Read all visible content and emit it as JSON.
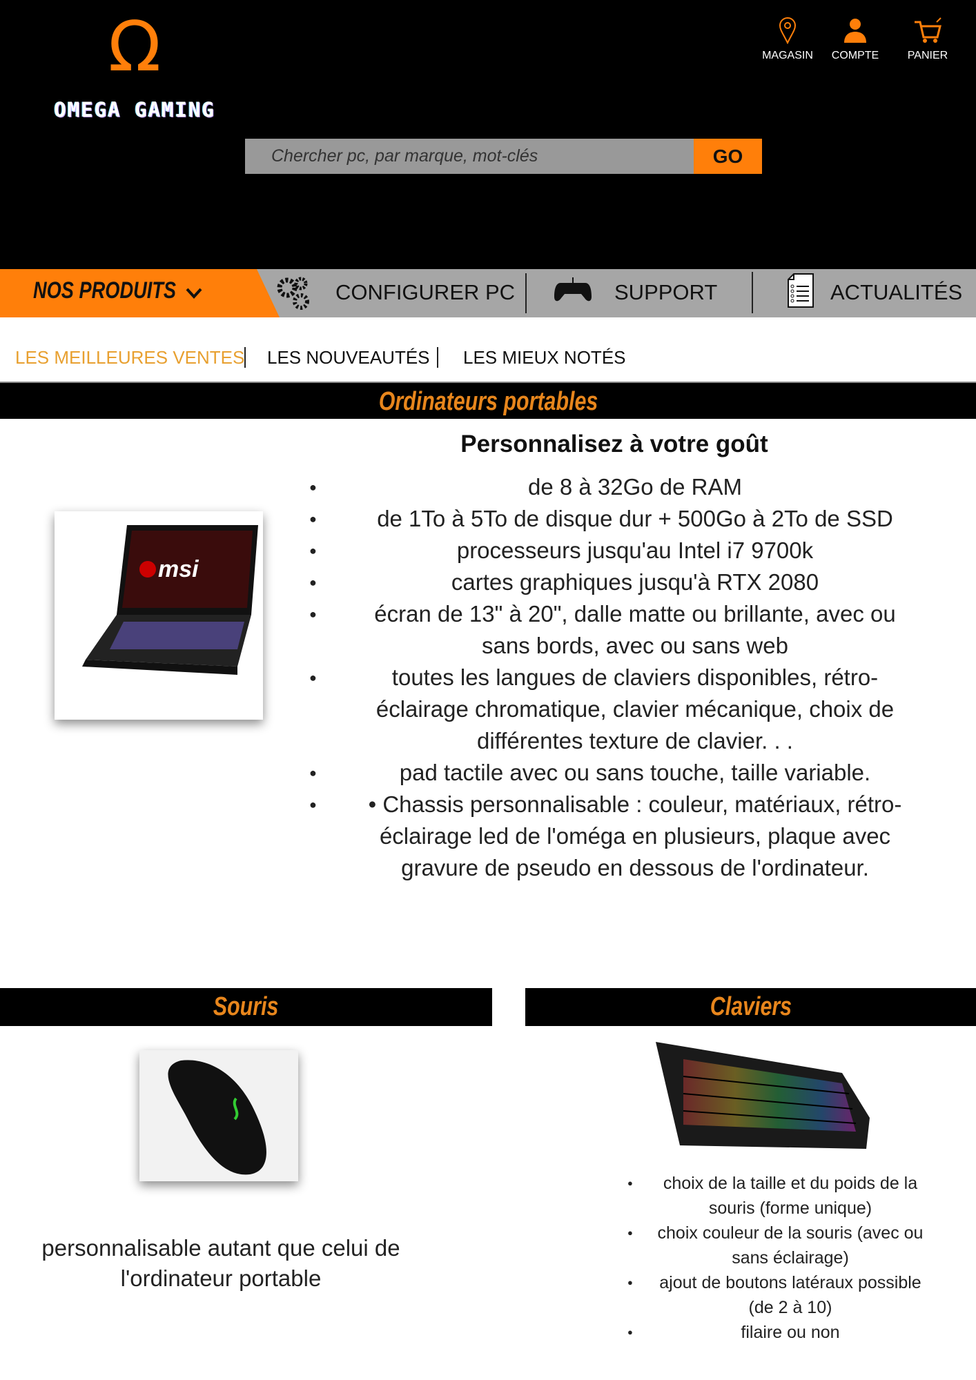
{
  "brand": {
    "logo_symbol": "Ω",
    "name": "OMEGA GAMING"
  },
  "top_icons": [
    {
      "label": "MAGASIN",
      "icon": "map-pin-icon"
    },
    {
      "label": "COMPTE",
      "icon": "user-icon"
    },
    {
      "label": "PANIER",
      "icon": "cart-icon"
    }
  ],
  "search": {
    "placeholder": "Chercher pc, par marque, mot-clés",
    "button": "GO"
  },
  "nav": {
    "products": "NOS PRODUITS",
    "items": [
      {
        "label": "CONFIGURER PC",
        "icon": "gears-icon"
      },
      {
        "label": "SUPPORT",
        "icon": "gamepad-icon"
      },
      {
        "label": "ACTUALITÉS",
        "icon": "document-icon"
      }
    ]
  },
  "subnav": [
    {
      "label": "LES MEILLEURES VENTES",
      "active": true
    },
    {
      "label": "LES NOUVEAUTÉS"
    },
    {
      "label": "LES MIEUX NOTÉS"
    }
  ],
  "laptops": {
    "title": "Ordinateurs portables",
    "heading": "Personnalisez à votre goût",
    "features": [
      "de 8 à 32Go de RAM",
      "de 1To à 5To de disque dur + 500Go à 2To de SSD",
      "processeurs jusqu'au Intel i7 9700k",
      "cartes graphiques jusqu'à RTX 2080",
      "écran de 13\" à 20\", dalle matte ou brillante, avec ou sans bords, avec ou sans web",
      "toutes les langues de claviers disponibles, rétro-éclairage chromatique, clavier mécanique, choix de différentes texture de clavier. . .",
      "pad tactile avec ou sans touche, taille variable.",
      "• Chassis personnalisable : couleur, matériaux, rétro-éclairage led de l'oméga en plusieurs, plaque avec gravure de pseudo en dessous de l'ordinateur."
    ]
  },
  "mice": {
    "title": "Souris",
    "text": "personnalisable autant que celui de l'ordinateur portable"
  },
  "keyboards": {
    "title": "Claviers",
    "features": [
      "choix de la taille et du poids de la souris (forme unique)",
      "choix couleur de la souris (avec ou sans éclairage)",
      "ajout de boutons latéraux possible (de 2 à 10)",
      "filaire ou non"
    ]
  },
  "colors": {
    "accent": "#ff7f0a",
    "title": "#e8861c",
    "nav": "#a6a6a6"
  }
}
